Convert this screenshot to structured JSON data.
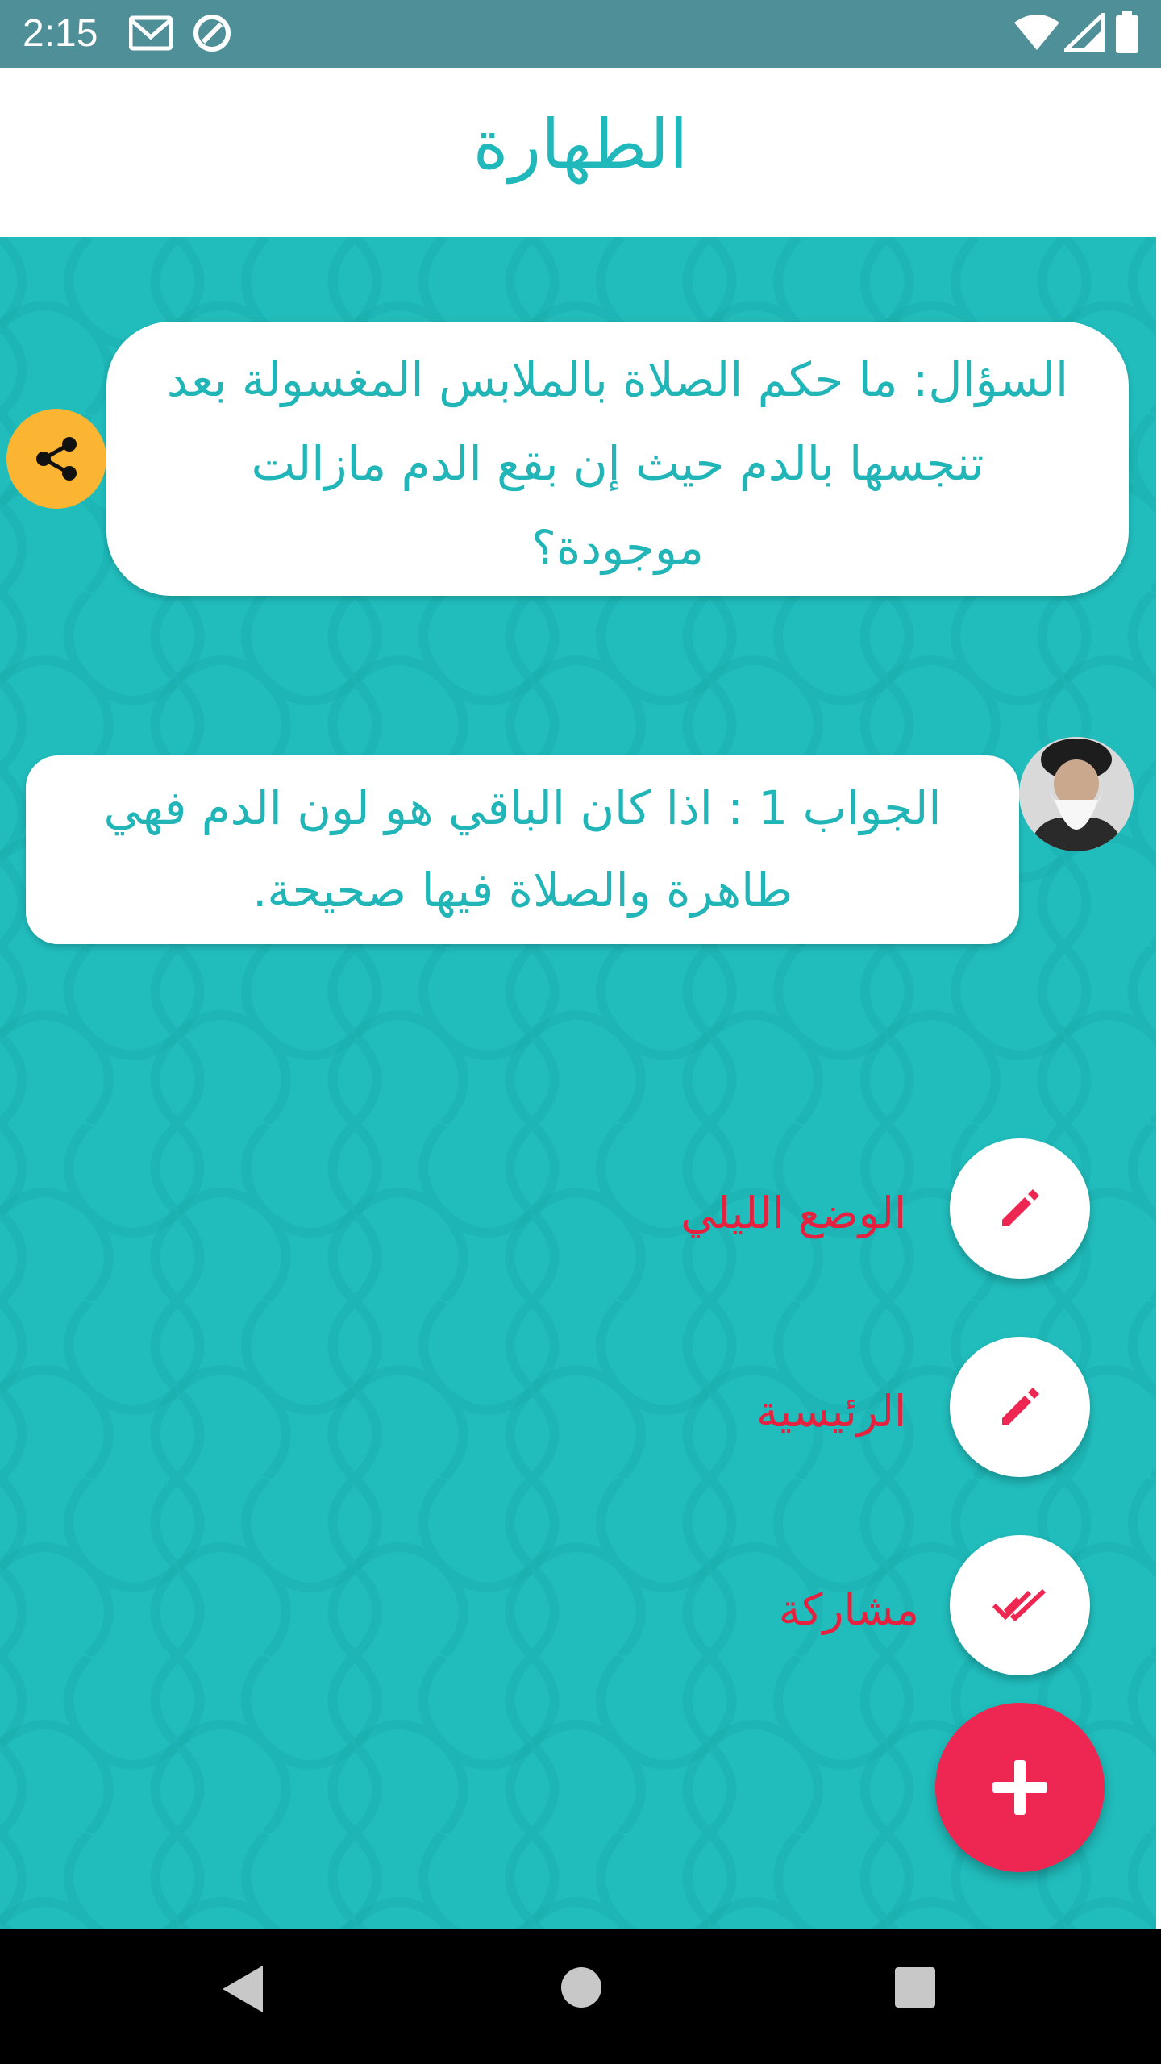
{
  "status_bar": {
    "time": "2:15"
  },
  "header": {
    "title": "الطهارة"
  },
  "question": {
    "text": "السؤال: ما حكم الصلاة بالملابس المغسولة بعد تنجسها بالدم حيث إن بقع الدم مازالت موجودة؟"
  },
  "answer": {
    "text": "الجواب 1 : اذا كان الباقي هو لون الدم فهي طاهرة والصلاة فيها صحيحة."
  },
  "speed_dial": {
    "items": [
      {
        "label": "الوضع الليلي",
        "icon": "pencil-icon"
      },
      {
        "label": "الرئيسية",
        "icon": "pencil-icon"
      },
      {
        "label": "مشاركة",
        "icon": "double-check-icon"
      }
    ],
    "main_icon": "plus-icon"
  },
  "colors": {
    "accent": "#21bcbc",
    "status_bar": "#4f8f97",
    "fab": "#ee2752",
    "share": "#fbb532",
    "label": "#e5213f"
  }
}
